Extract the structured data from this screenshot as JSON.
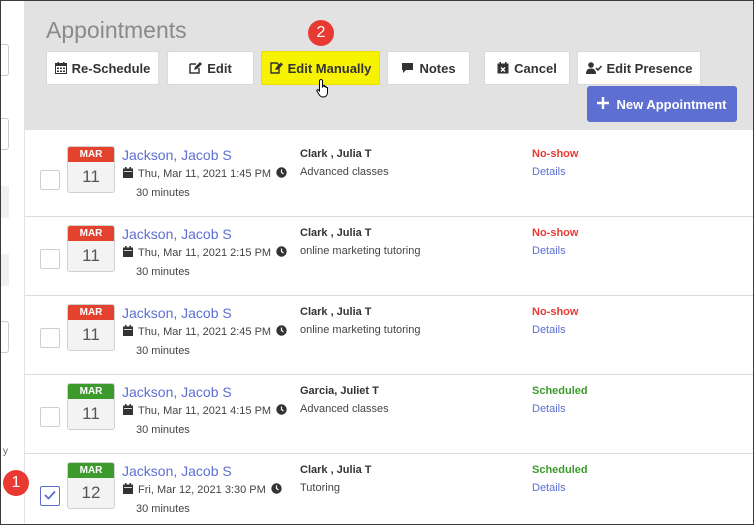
{
  "header": {
    "title": "Appointments",
    "toolbar": [
      {
        "key": "reschedule",
        "label": "Re-Schedule",
        "icon": "calendar-grid-icon"
      },
      {
        "key": "edit",
        "label": "Edit",
        "icon": "edit-pencil-icon"
      },
      {
        "key": "edit-manually",
        "label": "Edit Manually",
        "icon": "edit-document-icon"
      },
      {
        "key": "notes",
        "label": "Notes",
        "icon": "comment-icon"
      },
      {
        "key": "cancel",
        "label": "Cancel",
        "icon": "calendar-x-icon"
      },
      {
        "key": "edit-presence",
        "label": "Edit Presence",
        "icon": "user-check-icon"
      }
    ],
    "new_appointment_label": "New Appointment",
    "new_appointment_icon": "plus-icon"
  },
  "steps": {
    "one": "1",
    "two": "2"
  },
  "left_strip": {
    "letter": "y"
  },
  "colors": {
    "accent": "#5d6fd1",
    "highlight": "#f6f200",
    "no_show": "#e83a33",
    "scheduled": "#3c9b2c",
    "badge": "#e83a33"
  },
  "appointments": [
    {
      "month": "MAR",
      "day": "11",
      "name": "Jackson, Jacob S",
      "datetime": "Thu, Mar 11, 2021 1:45 PM",
      "duration": "30 minutes",
      "provider": "Clark , Julia T",
      "service": "Advanced classes",
      "status": "No-show",
      "details": "Details",
      "checked": false
    },
    {
      "month": "MAR",
      "day": "11",
      "name": "Jackson, Jacob S",
      "datetime": "Thu, Mar 11, 2021 2:15 PM",
      "duration": "30 minutes",
      "provider": "Clark , Julia T",
      "service": "online marketing tutoring",
      "status": "No-show",
      "details": "Details",
      "checked": false
    },
    {
      "month": "MAR",
      "day": "11",
      "name": "Jackson, Jacob S",
      "datetime": "Thu, Mar 11, 2021 2:45 PM",
      "duration": "30 minutes",
      "provider": "Clark , Julia T",
      "service": "online marketing tutoring",
      "status": "No-show",
      "details": "Details",
      "checked": false
    },
    {
      "month": "MAR",
      "day": "11",
      "name": "Jackson, Jacob S",
      "datetime": "Thu, Mar 11, 2021 4:15 PM",
      "duration": "30 minutes",
      "provider": "Garcia, Juliet T",
      "service": "Advanced classes",
      "status": "Scheduled",
      "details": "Details",
      "checked": false
    },
    {
      "month": "MAR",
      "day": "12",
      "name": "Jackson, Jacob S",
      "datetime": "Fri, Mar 12, 2021 3:30 PM",
      "duration": "30 minutes",
      "provider": "Clark , Julia T",
      "service": "Tutoring",
      "status": "Scheduled",
      "details": "Details",
      "checked": true
    }
  ]
}
